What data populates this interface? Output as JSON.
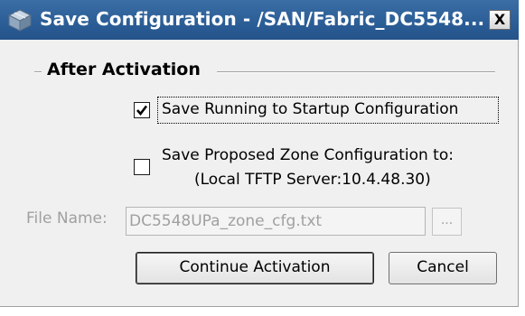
{
  "dialog": {
    "title": "Save Configuration - /SAN/Fabric_DC5548...",
    "close_label": "X",
    "title_icon": "cube-icon"
  },
  "group": {
    "title": "After Activation"
  },
  "options": {
    "save_running": {
      "label": "Save Running to Startup Configuration",
      "checked": true
    },
    "save_proposed": {
      "label_line1": "Save Proposed Zone Configuration to:",
      "label_line2": "(Local TFTP Server:10.4.48.30)",
      "checked": false
    }
  },
  "file": {
    "label": "File Name:",
    "value": "DC5548UPa_zone_cfg.txt",
    "browse_label": "..."
  },
  "buttons": {
    "continue_label": "Continue Activation",
    "cancel_label": "Cancel"
  },
  "colors": {
    "titlebar": "#2b5d96",
    "window_bg": "#f0f0f0",
    "disabled_text": "#a0a0a0"
  }
}
